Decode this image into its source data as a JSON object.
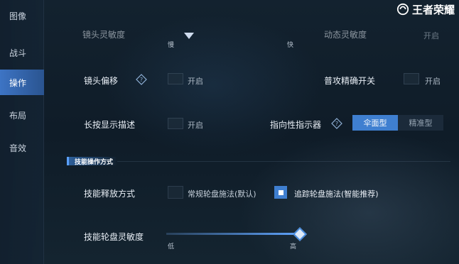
{
  "watermark": {
    "text": "王者荣耀"
  },
  "sidebar": {
    "items": [
      {
        "label": "图像"
      },
      {
        "label": "战斗"
      },
      {
        "label": "操作",
        "active": true
      },
      {
        "label": "布局"
      },
      {
        "label": "音效"
      }
    ]
  },
  "settings": {
    "lens_sensitivity": {
      "label": "镜头灵敏度",
      "low": "慢",
      "high": "快"
    },
    "dynamic_sensitivity": {
      "label": "动态灵敏度",
      "value": "开启"
    },
    "lens_offset": {
      "label": "镜头偏移",
      "value": "开启"
    },
    "attack_precision": {
      "label": "普攻精确开关",
      "value": "开启"
    },
    "long_press_desc": {
      "label": "长按显示描述",
      "value": "开启"
    },
    "directional_indicator": {
      "label": "指向性指示器",
      "options": [
        "伞面型",
        "精准型"
      ],
      "selected": "伞面型"
    }
  },
  "skill_section": {
    "title": "技能操作方式",
    "release_mode": {
      "label": "技能释放方式",
      "option_a": "常规轮盘施法(默认)",
      "option_b": "追踪轮盘施法(智能推荐)",
      "selected": "option_b"
    },
    "wheel_sensitivity": {
      "label": "技能轮盘灵敏度",
      "low": "低",
      "high": "高",
      "level": 1.0
    }
  },
  "colors": {
    "accent": "#3f7fd0",
    "active_nav": "#3d74c4"
  }
}
